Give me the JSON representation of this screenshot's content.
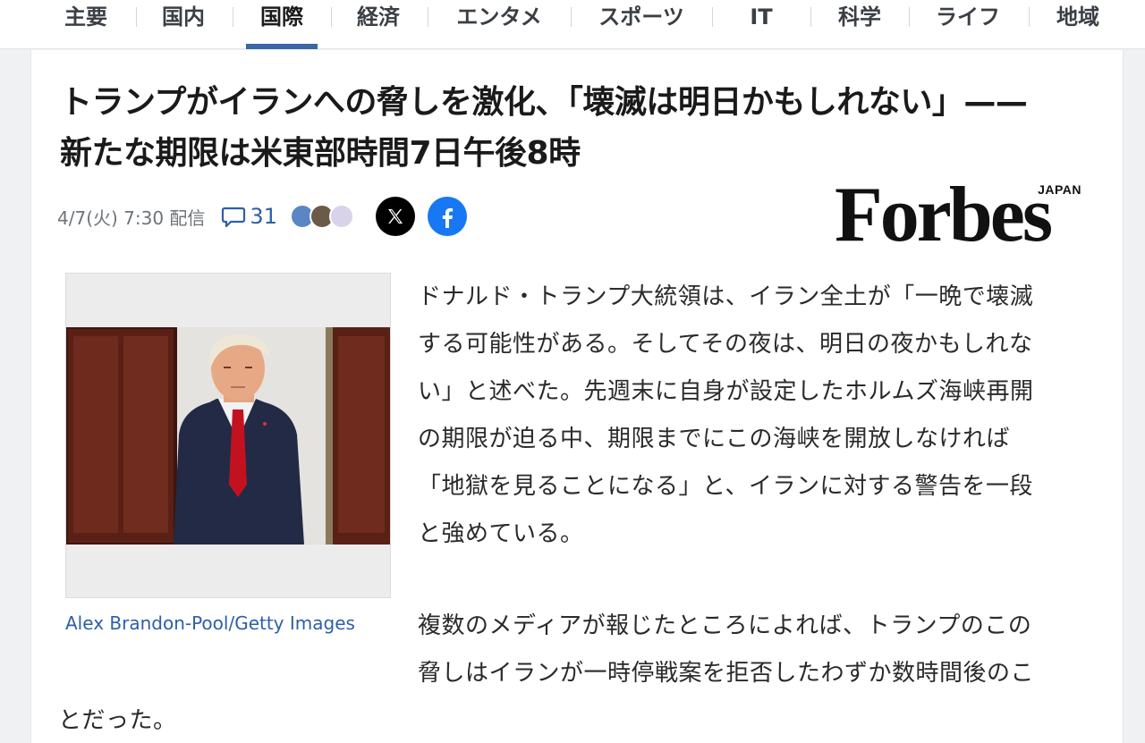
{
  "nav": {
    "tabs": [
      {
        "label": "主要"
      },
      {
        "label": "国内"
      },
      {
        "label": "国際",
        "active": true
      },
      {
        "label": "経済"
      },
      {
        "label": "エンタメ"
      },
      {
        "label": "スポーツ"
      },
      {
        "label": "IT"
      },
      {
        "label": "科学"
      },
      {
        "label": "ライフ"
      },
      {
        "label": "地域"
      }
    ]
  },
  "article": {
    "headline_line1": "トランプがイランへの脅しを激化、「壊滅は明日かもしれない」——",
    "headline_line2": "新たな期限は米東部時間7日午後8時",
    "date": "4/7(火) 7:30 配信",
    "comment_count": "31",
    "publisher_logo": {
      "main": "Forbes",
      "sub": "JAPAN"
    },
    "photo_caption": "Alex Brandon-Pool/Getty Images",
    "paragraph1_lines": [
      "ドナルド・トランプ大統領は、イラン全土が「一晩で壊滅",
      "する可能性がある。そしてその夜は、明日の夜かもしれな",
      "い」と述べた。先週末に自身が設定したホルムズ海峡再開",
      "の期限が迫る中、期限までにこの海峡を開放しなければ",
      "「地獄を見ることになる」と、イランに対する警告を一段",
      "と強めている。"
    ],
    "paragraph2_lines": [
      "複数のメディアが報じたところによれば、トランプのこの",
      "脅しはイランが一時停戦案を拒否したわずか数時間後のこ"
    ],
    "paragraph2_tail": "とだった。"
  },
  "icons": {
    "comment": "speech-bubble-icon",
    "share_x": "x-logo-icon",
    "share_facebook": "facebook-logo-icon"
  },
  "colors": {
    "accent_blue": "#2d5fa8",
    "nav_active_underline": "#3a66a8",
    "facebook_blue": "#1877f2"
  }
}
